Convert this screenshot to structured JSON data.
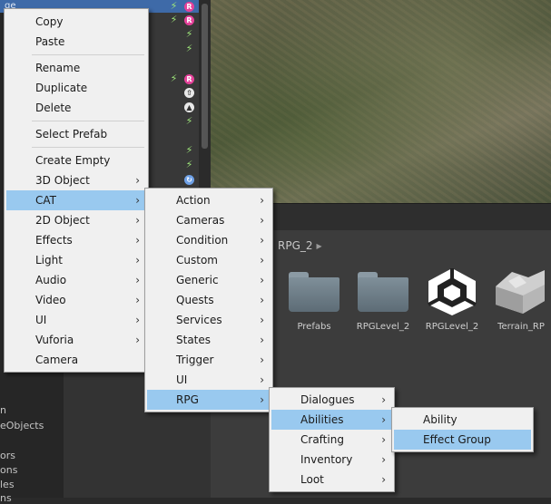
{
  "hierarchy": {
    "selected_fragment": "ge",
    "side_texts": [
      "n",
      "eObjects",
      "ors",
      "ons",
      "les",
      "ns"
    ]
  },
  "project": {
    "breadcrumb": "RPG_2",
    "assets": [
      {
        "label": "Prefabs",
        "icon": "folder-icon"
      },
      {
        "label": "RPGLevel_2",
        "icon": "folder-icon"
      },
      {
        "label": "RPGLevel_2",
        "icon": "unity-logo-icon"
      },
      {
        "label": "Terrain_RP",
        "icon": "terrain-icon"
      }
    ]
  },
  "context_menu": {
    "items": [
      "Copy",
      "Paste",
      "Rename",
      "Duplicate",
      "Delete",
      "Select Prefab",
      "Create Empty",
      "3D Object",
      "CAT",
      "2D Object",
      "Effects",
      "Light",
      "Audio",
      "Video",
      "UI",
      "Vuforia",
      "Camera"
    ]
  },
  "cat_menu": {
    "items": [
      "Action",
      "Cameras",
      "Condition",
      "Custom",
      "Generic",
      "Quests",
      "Services",
      "States",
      "Trigger",
      "UI",
      "RPG"
    ]
  },
  "rpg_menu": {
    "items": [
      "Dialogues",
      "Abilities",
      "Crafting",
      "Inventory",
      "Loot"
    ]
  },
  "abilities_menu": {
    "items": [
      "Ability",
      "Effect Group"
    ]
  },
  "colors": {
    "highlight": "#99c9ef",
    "menu_bg": "#f0f0f0",
    "selection": "#3e6aa8"
  }
}
